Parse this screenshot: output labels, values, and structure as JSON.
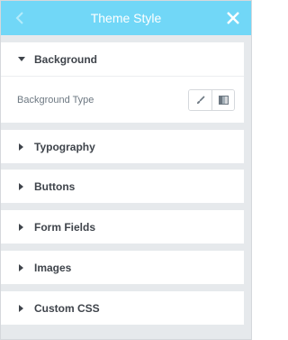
{
  "header": {
    "title": "Theme Style",
    "back_icon": "chevron-left-icon",
    "close_icon": "close-icon",
    "bg_color": "#71d7f7"
  },
  "sections": {
    "background": {
      "label": "Background",
      "expanded": true,
      "control": {
        "label": "Background Type",
        "options": [
          "classic-brush-icon",
          "gradient-icon"
        ]
      }
    },
    "typography": {
      "label": "Typography",
      "expanded": false
    },
    "buttons": {
      "label": "Buttons",
      "expanded": false
    },
    "form_fields": {
      "label": "Form Fields",
      "expanded": false
    },
    "images": {
      "label": "Images",
      "expanded": false
    },
    "custom_css": {
      "label": "Custom CSS",
      "expanded": false
    }
  }
}
